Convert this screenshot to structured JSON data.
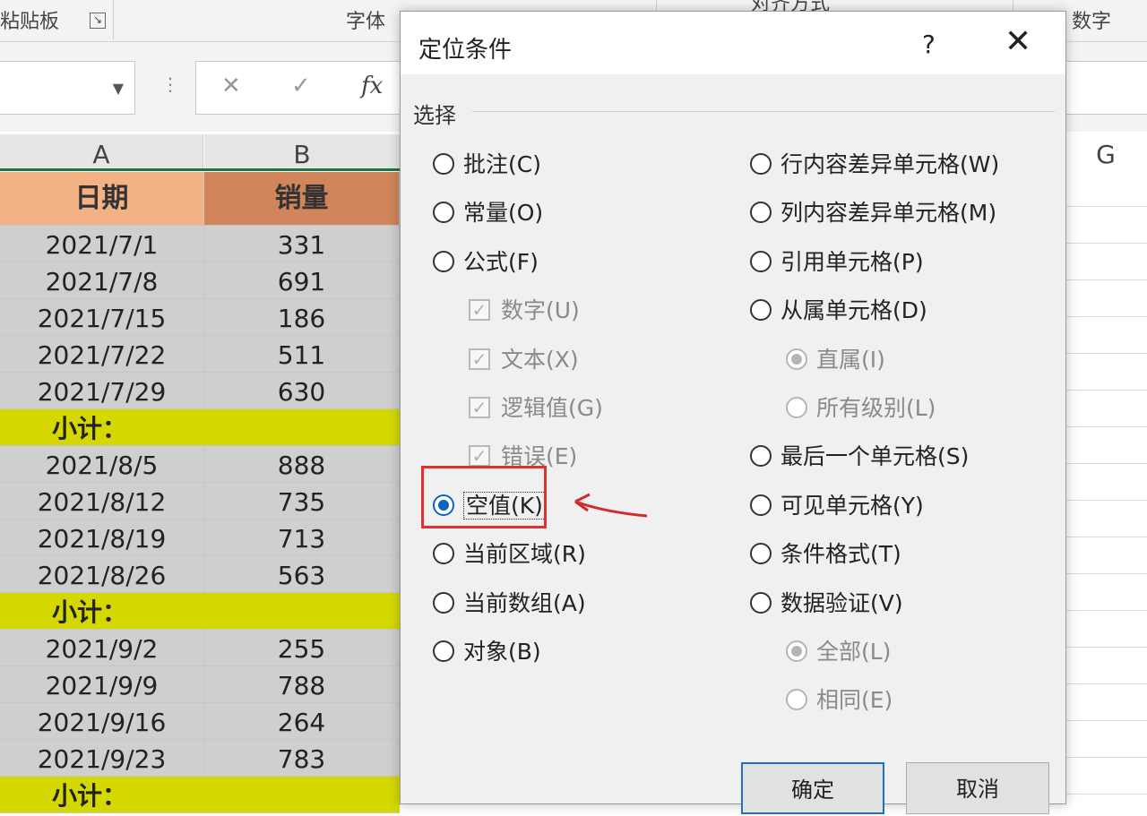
{
  "ribbon": {
    "groups": [
      "粘贴板",
      "字体",
      "对齐方式",
      "数字"
    ]
  },
  "formula_bar": {
    "fx_label": "fx",
    "cancel_icon": "x-icon",
    "enter_icon": "check-icon"
  },
  "columns": {
    "a": "A",
    "b": "B",
    "g": "G"
  },
  "table": {
    "headers": [
      "日期",
      "销量"
    ],
    "subtotal_label": "小计：",
    "rows": [
      {
        "date": "2021/7/1",
        "sales": "331"
      },
      {
        "date": "2021/7/8",
        "sales": "691"
      },
      {
        "date": "2021/7/15",
        "sales": "186"
      },
      {
        "date": "2021/7/22",
        "sales": "511"
      },
      {
        "date": "2021/7/29",
        "sales": "630"
      },
      {
        "subtotal": true
      },
      {
        "date": "2021/8/5",
        "sales": "888"
      },
      {
        "date": "2021/8/12",
        "sales": "735"
      },
      {
        "date": "2021/8/19",
        "sales": "713"
      },
      {
        "date": "2021/8/26",
        "sales": "563"
      },
      {
        "subtotal": true
      },
      {
        "date": "2021/9/2",
        "sales": "255"
      },
      {
        "date": "2021/9/9",
        "sales": "788"
      },
      {
        "date": "2021/9/16",
        "sales": "264"
      },
      {
        "date": "2021/9/23",
        "sales": "783"
      },
      {
        "subtotal": true
      }
    ]
  },
  "dialog": {
    "title": "定位条件",
    "help": "?",
    "close": "✕",
    "section": "选择",
    "left_options": [
      {
        "label": "批注(C)",
        "kind": "radio"
      },
      {
        "label": "常量(O)",
        "kind": "radio"
      },
      {
        "label": "公式(F)",
        "kind": "radio"
      },
      {
        "label": "数字(U)",
        "kind": "check",
        "disabled": true
      },
      {
        "label": "文本(X)",
        "kind": "check",
        "disabled": true
      },
      {
        "label": "逻辑值(G)",
        "kind": "check",
        "disabled": true
      },
      {
        "label": "错误(E)",
        "kind": "check",
        "disabled": true
      },
      {
        "label": "空值(K)",
        "kind": "radio",
        "selected": true
      },
      {
        "label": "当前区域(R)",
        "kind": "radio"
      },
      {
        "label": "当前数组(A)",
        "kind": "radio"
      },
      {
        "label": "对象(B)",
        "kind": "radio"
      }
    ],
    "right_options": [
      {
        "label": "行内容差异单元格(W)",
        "kind": "radio"
      },
      {
        "label": "列内容差异单元格(M)",
        "kind": "radio"
      },
      {
        "label": "引用单元格(P)",
        "kind": "radio"
      },
      {
        "label": "从属单元格(D)",
        "kind": "radio"
      },
      {
        "label": "直属(I)",
        "kind": "radio",
        "disabled": true,
        "selected": true,
        "indent": true
      },
      {
        "label": "所有级别(L)",
        "kind": "radio",
        "disabled": true,
        "indent": true
      },
      {
        "label": "最后一个单元格(S)",
        "kind": "radio"
      },
      {
        "label": "可见单元格(Y)",
        "kind": "radio"
      },
      {
        "label": "条件格式(T)",
        "kind": "radio"
      },
      {
        "label": "数据验证(V)",
        "kind": "radio"
      },
      {
        "label": "全部(L)",
        "kind": "radio",
        "disabled": true,
        "selected": true,
        "indent": true
      },
      {
        "label": "相同(E)",
        "kind": "radio",
        "disabled": true,
        "indent": true
      }
    ],
    "ok": "确定",
    "cancel": "取消"
  },
  "colors": {
    "highlight": "#e03030",
    "accent": "#0a64c8",
    "header_a": "#f4b183",
    "subtotal": "#d4d800"
  }
}
